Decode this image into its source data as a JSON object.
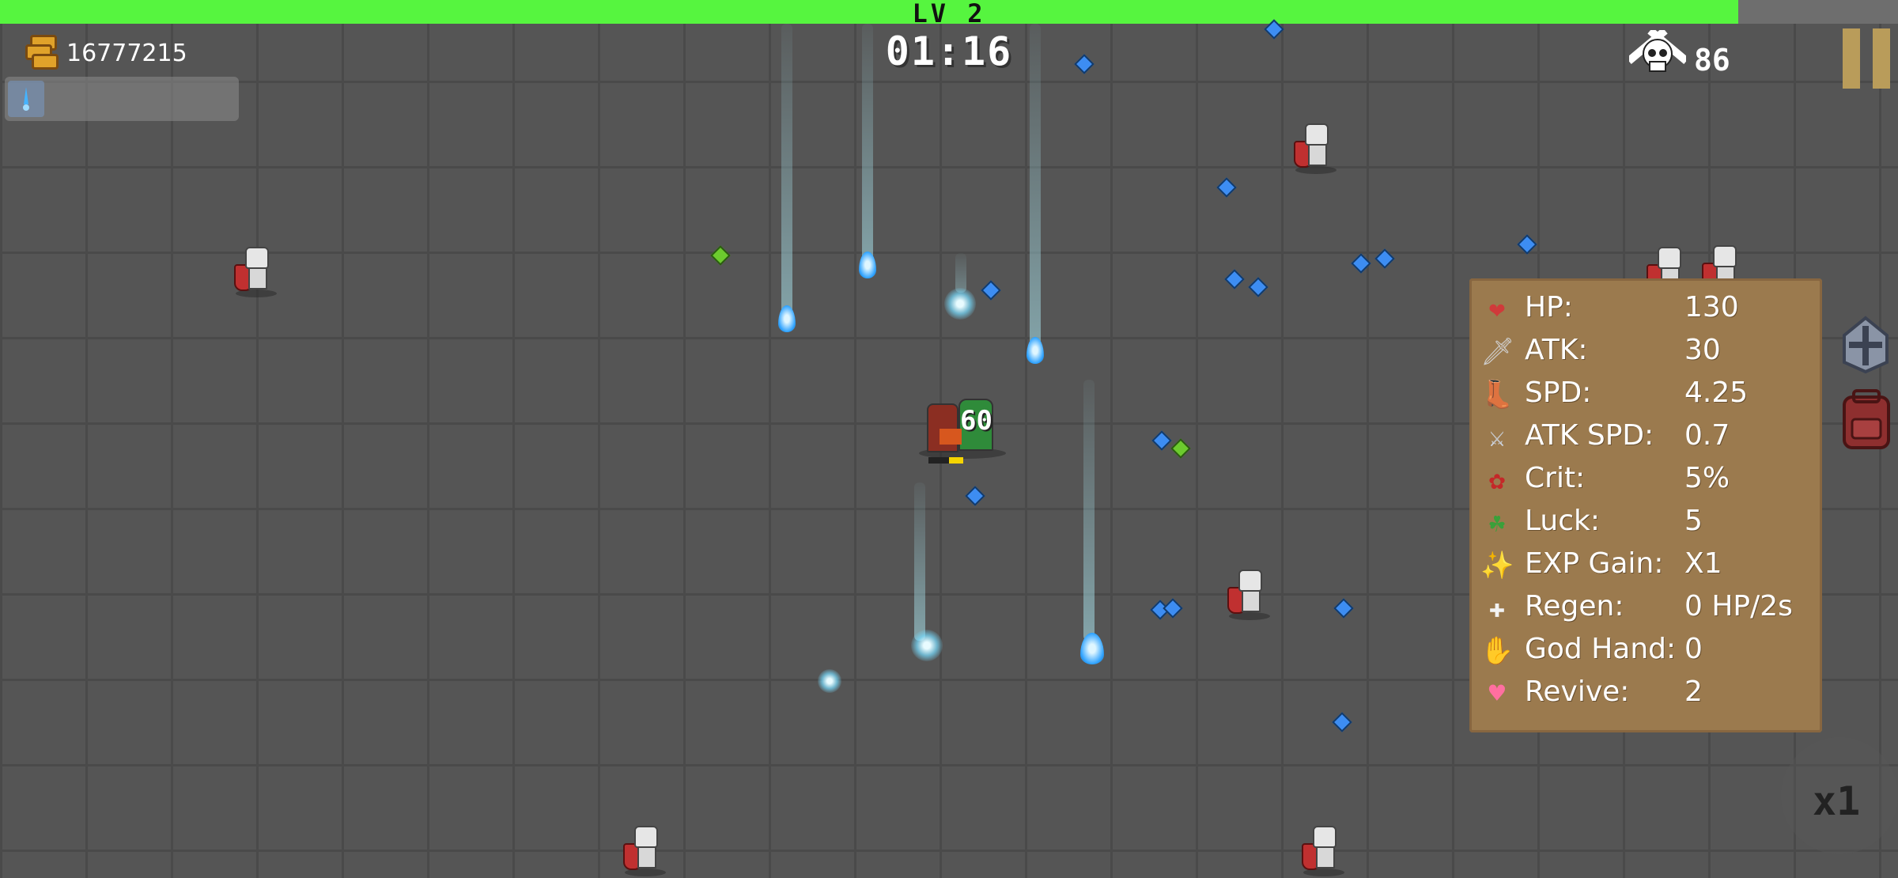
{
  "hud": {
    "level_label": "LV 2",
    "xp_progress": 0.916,
    "gold": "16777215",
    "timer": "01:16",
    "kills": "86",
    "speed_label": "x1"
  },
  "stats": [
    {
      "icon": "heart-icon",
      "label": "HP:",
      "value": "130"
    },
    {
      "icon": "sword-icon",
      "label": "ATK:",
      "value": "30"
    },
    {
      "icon": "boot-icon",
      "label": "SPD:",
      "value": "4.25"
    },
    {
      "icon": "swift-sword-icon",
      "label": "ATK SPD:",
      "value": "0.7"
    },
    {
      "icon": "rose-icon",
      "label": "Crit:",
      "value": "5%"
    },
    {
      "icon": "leaf-icon",
      "label": "Luck:",
      "value": "5"
    },
    {
      "icon": "sparkle-icon",
      "label": "EXP Gain:",
      "value": "X1"
    },
    {
      "icon": "regen-icon",
      "label": "Regen:",
      "value": "0 HP/2s"
    },
    {
      "icon": "god-hand-icon",
      "label": "God Hand:",
      "value": "0"
    },
    {
      "icon": "pink-heart-icon",
      "label": "Revive:",
      "value": "2"
    }
  ],
  "combat": {
    "damage_number": "60"
  },
  "colors": {
    "xp_bar": "#56f53f",
    "panel": "#9b7a4e",
    "floor": "#555555",
    "gem_blue": "#3d8df2",
    "gem_green": "#6ccb2e"
  }
}
